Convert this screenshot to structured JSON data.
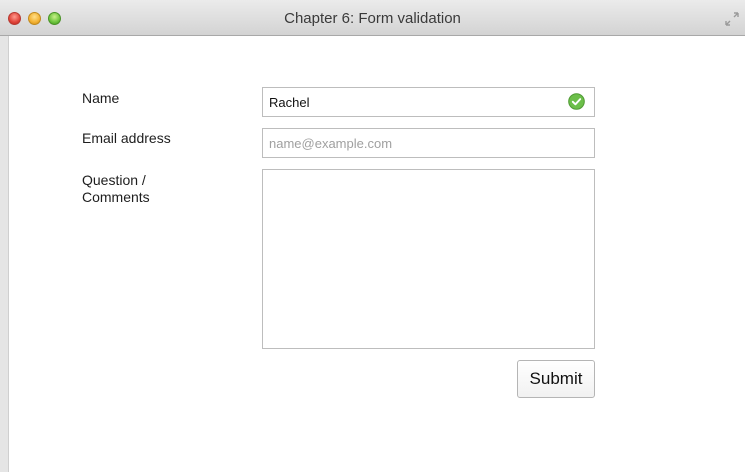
{
  "window": {
    "title": "Chapter 6: Form validation"
  },
  "form": {
    "name_label": "Name",
    "name_value": "Rachel",
    "name_status_icon": "check-circle-icon",
    "name_status_color": "#6cbf4a",
    "email_label": "Email address",
    "email_placeholder": "name@example.com",
    "email_value": "",
    "comments_label_line1": "Question /",
    "comments_label_line2": "Comments",
    "comments_value": "",
    "submit_label": "Submit"
  }
}
